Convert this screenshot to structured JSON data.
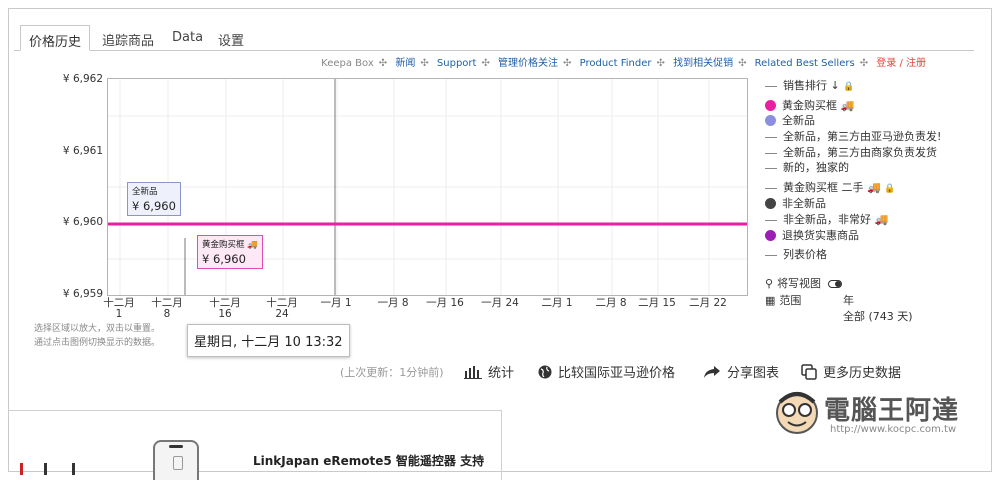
{
  "tabs": [
    "价格历史",
    "追踪商品",
    "Data",
    "设置"
  ],
  "toplinks": {
    "keepa_box": "Keepa Box",
    "links": [
      "新闻",
      "Support",
      "管理价格关注",
      "Product Finder",
      "找到相关促销",
      "Related Best Sellers"
    ],
    "login": "登录 / 注册"
  },
  "chart": {
    "y_ticks": [
      "¥ 6,962",
      "¥ 6,961",
      "¥ 6,960",
      "¥ 6,959"
    ],
    "x_ticks": [
      {
        "top": "十二月",
        "bottom": "1"
      },
      {
        "top": "十二月",
        "bottom": "8"
      },
      {
        "top": "十二月",
        "bottom": "16"
      },
      {
        "top": "十二月",
        "bottom": "24"
      },
      {
        "top": "一月 1",
        "bottom": ""
      },
      {
        "top": "一月 8",
        "bottom": ""
      },
      {
        "top": "一月 16",
        "bottom": ""
      },
      {
        "top": "一月 24",
        "bottom": ""
      },
      {
        "top": "二月 1",
        "bottom": ""
      },
      {
        "top": "二月 8",
        "bottom": ""
      },
      {
        "top": "二月 15",
        "bottom": ""
      },
      {
        "top": "二月 22",
        "bottom": ""
      }
    ],
    "line_color": "#e91ea0",
    "tooltip_new": {
      "label": "全新品",
      "value": "¥ 6,960"
    },
    "tooltip_buybox": {
      "label": "黄金购买框 🚚",
      "value": "¥ 6,960"
    },
    "date_flag": "星期日, 十二月 10 13:32",
    "hint_line1": "选择区域以放大，双击以重置。",
    "hint_line2": "通过点击图例切换显示的数据。"
  },
  "legend": {
    "items": [
      {
        "kind": "dash",
        "label": "销售排行 ↓",
        "lock": true
      },
      {
        "kind": "dot",
        "color": "#e91ea0",
        "label": "黄金购买框 🚚"
      },
      {
        "kind": "dot",
        "color": "#8a8fe0",
        "label": "全新品"
      },
      {
        "kind": "dash",
        "label": "全新品，第三方由亚马逊负责发!"
      },
      {
        "kind": "dash",
        "label": "全新品，第三方由商家负责发货"
      },
      {
        "kind": "dash",
        "label": "新的，独家的"
      },
      {
        "kind": "dash",
        "label": "黄金购买框 二手 🚚",
        "lock": true
      },
      {
        "kind": "dot",
        "color": "#444444",
        "label": "非全新品"
      },
      {
        "kind": "dash",
        "label": "非全新品，非常好 🚚"
      },
      {
        "kind": "dot",
        "color": "#9b1fb5",
        "label": "退换货实惠商品"
      },
      {
        "kind": "dash",
        "label": "列表价格"
      }
    ],
    "close_view": "将写视图",
    "range_label": "范围",
    "range_year": "年",
    "range_all": "全部 (743 天)"
  },
  "actions": {
    "last_update": "(上次更新：1分钟前)",
    "stats": "统计",
    "compare": "比较国际亚马逊价格",
    "share": "分享图表",
    "more": "更多历史数据"
  },
  "product": {
    "title": "LinkJapan eRemote5 智能遥控器 支持"
  },
  "watermark": {
    "name": "電腦王阿達",
    "url": "http://www.kocpc.com.tw"
  }
}
